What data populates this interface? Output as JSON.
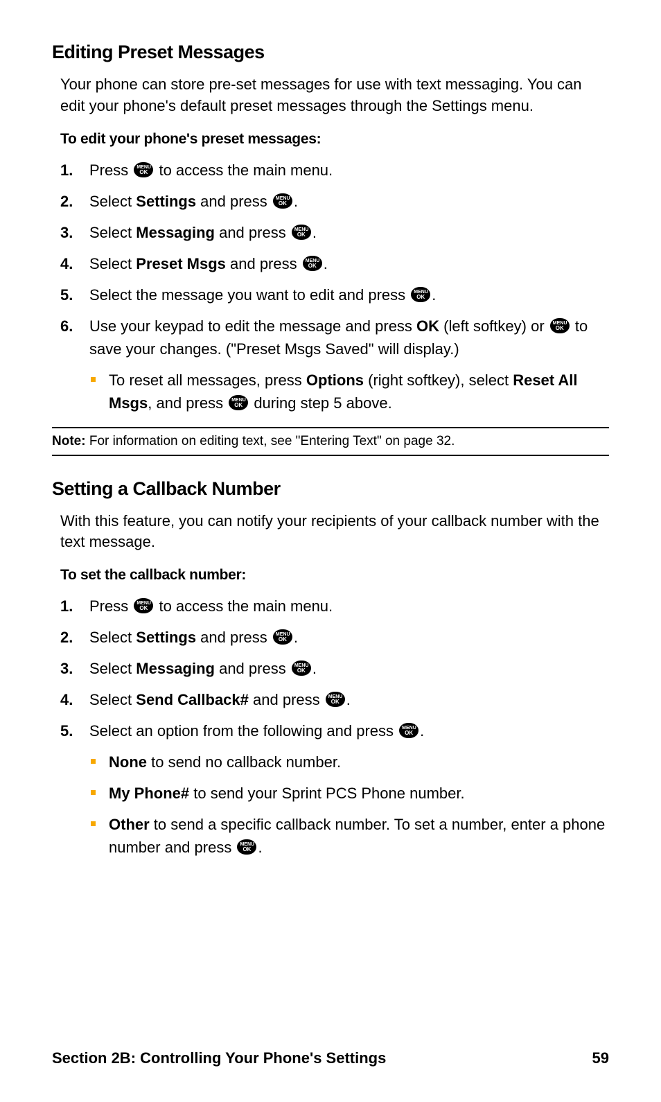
{
  "section1": {
    "heading": "Editing Preset Messages",
    "intro": "Your phone can store pre-set messages for use with text messaging. You can edit your phone's default preset messages through the Settings menu.",
    "subheading": "To edit your phone's preset messages:",
    "steps": {
      "s1a": "Press ",
      "s1b": " to access the main menu.",
      "s2a": "Select ",
      "s2b": "Settings",
      "s2c": " and press ",
      "s2d": ".",
      "s3a": "Select ",
      "s3b": "Messaging",
      "s3c": " and press ",
      "s3d": ".",
      "s4a": "Select ",
      "s4b": "Preset Msgs",
      "s4c": " and press ",
      "s4d": ".",
      "s5a": "Select the message you want to edit and press ",
      "s5b": ".",
      "s6a": "Use your keypad to edit the message and press ",
      "s6b": "OK",
      "s6c": " (left softkey) or ",
      "s6d": " to save your changes. (\"Preset Msgs Saved\" will display.)",
      "s6sub_a": "To reset all messages, press ",
      "s6sub_b": "Options",
      "s6sub_c": " (right softkey), select ",
      "s6sub_d": "Reset All Msgs",
      "s6sub_e": ", and press ",
      "s6sub_f": " during step 5 above."
    }
  },
  "note": {
    "label": "Note:",
    "text": " For information on editing text, see \"Entering Text\" on page 32."
  },
  "section2": {
    "heading": "Setting a Callback Number",
    "intro": "With this feature, you can notify your recipients of your callback number with the text message.",
    "subheading": "To set the callback number:",
    "steps": {
      "s1a": "Press ",
      "s1b": " to access the main menu.",
      "s2a": "Select ",
      "s2b": "Settings",
      "s2c": " and press ",
      "s2d": ".",
      "s3a": "Select ",
      "s3b": "Messaging",
      "s3c": " and press ",
      "s3d": ".",
      "s4a": "Select ",
      "s4b": "Send Callback#",
      "s4c": " and press ",
      "s4d": ".",
      "s5a": "Select an option from the following and press ",
      "s5b": ".",
      "opt1a": "None",
      "opt1b": " to send no callback number.",
      "opt2a": "My Phone#",
      "opt2b": " to send your Sprint PCS Phone number.",
      "opt3a": "Other",
      "opt3b": " to send a specific callback number. To set a number, enter a phone number and press ",
      "opt3c": "."
    }
  },
  "footer": {
    "section": "Section 2B: Controlling Your Phone's Settings",
    "page": "59"
  },
  "icon": {
    "menu": "MENU",
    "ok": "OK"
  }
}
